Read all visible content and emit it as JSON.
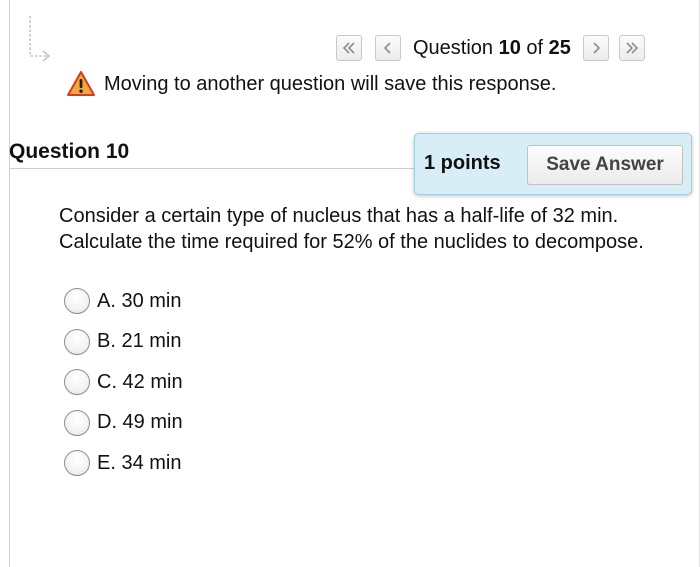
{
  "navigation": {
    "first_icon": "double-chevron-left-icon",
    "prev_icon": "chevron-left-icon",
    "next_icon": "chevron-right-icon",
    "last_icon": "double-chevron-right-icon",
    "counter_prefix": "Question ",
    "current": "10",
    "counter_of": " of ",
    "total": "25"
  },
  "warning": {
    "icon": "warning-triangle-icon",
    "text": "Moving to another question will save this response."
  },
  "question": {
    "heading": "Question 10",
    "points_label": "1 points",
    "save_label": "Save Answer",
    "text": "Consider a certain type of nucleus that has a half-life of 32 min. Calculate the time required for 52% of the nuclides to decompose.",
    "options": [
      {
        "label": "A. 30 min",
        "selected": false
      },
      {
        "label": "B. 21 min",
        "selected": false
      },
      {
        "label": "C. 42 min",
        "selected": false
      },
      {
        "label": "D. 49 min",
        "selected": false
      },
      {
        "label": "E. 34 min",
        "selected": false
      }
    ]
  },
  "colors": {
    "panel_background": "#d7eef6",
    "panel_border": "#9fcfe0",
    "warning_fill": "#f2a93b",
    "warning_stroke": "#d33c1c"
  }
}
